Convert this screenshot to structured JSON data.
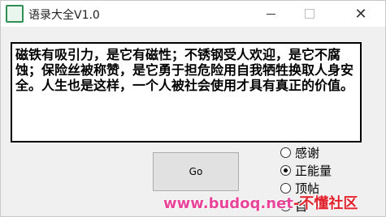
{
  "window": {
    "title": "语录大全V1.0"
  },
  "controls": {
    "minimize": "—",
    "maximize": "□",
    "close": "✕"
  },
  "content": {
    "text": "磁铁有吸引力，是它有磁性；不锈钢受人欢迎，是它不腐蚀；保险丝被称赞，是它勇于担危险用自我牺牲换取人身安全。人生也是这样，一个人被社会使用才具有真正的价值。"
  },
  "buttons": {
    "go": "Go"
  },
  "radios": [
    {
      "label": "感谢",
      "checked": false
    },
    {
      "label": "正能量",
      "checked": true
    },
    {
      "label": "顶帖",
      "checked": false
    },
    {
      "label": "自",
      "checked": false
    }
  ],
  "watermark": {
    "site": "www.budoq.net",
    "suffix": "-不懂社区"
  },
  "colors": {
    "accent_green": "#2f8f55",
    "watermark_pink": "#e8449a",
    "watermark_red": "#e0232c"
  }
}
